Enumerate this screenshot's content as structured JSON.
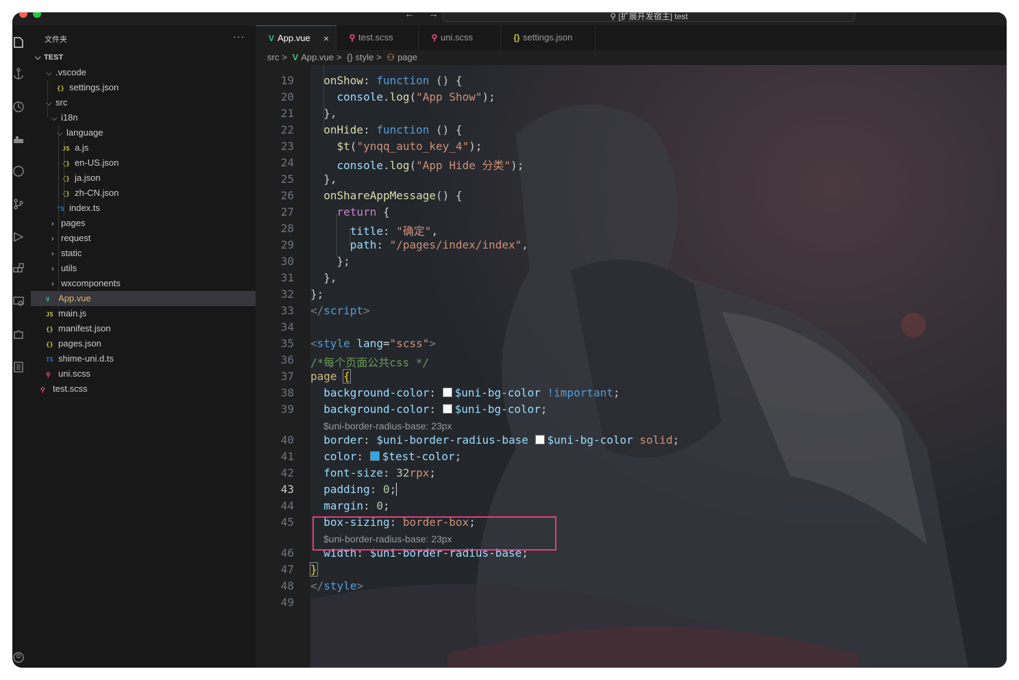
{
  "window": {
    "nav": "← →",
    "command_center": "⚲ [扩展开发宿主] test"
  },
  "sidebar": {
    "title": "文件夹",
    "more": "···",
    "root": "TEST",
    "tree": [
      {
        "label": ".vscode",
        "icon": "",
        "type": "folder-open"
      },
      {
        "label": "settings.json",
        "icon": "{}",
        "type": "json"
      },
      {
        "label": "src",
        "icon": "",
        "type": "folder-open"
      },
      {
        "label": "i18n",
        "icon": "",
        "type": "folder-open"
      },
      {
        "label": "language",
        "icon": "",
        "type": "folder-open"
      },
      {
        "label": "a.js",
        "icon": "JS",
        "type": "js"
      },
      {
        "label": "en-US.json",
        "icon": "{}",
        "type": "json"
      },
      {
        "label": "ja.json",
        "icon": "{}",
        "type": "json"
      },
      {
        "label": "zh-CN.json",
        "icon": "{}",
        "type": "json"
      },
      {
        "label": "index.ts",
        "icon": "TS",
        "type": "ts"
      },
      {
        "label": "pages",
        "icon": "",
        "type": "folder"
      },
      {
        "label": "request",
        "icon": "",
        "type": "folder"
      },
      {
        "label": "static",
        "icon": "",
        "type": "folder"
      },
      {
        "label": "utils",
        "icon": "",
        "type": "folder"
      },
      {
        "label": "wxcomponents",
        "icon": "",
        "type": "folder"
      },
      {
        "label": "App.vue",
        "icon": "V",
        "type": "vue"
      },
      {
        "label": "main.js",
        "icon": "JS",
        "type": "js"
      },
      {
        "label": "manifest.json",
        "icon": "{}",
        "type": "json"
      },
      {
        "label": "pages.json",
        "icon": "{}",
        "type": "json"
      },
      {
        "label": "shime-uni.d.ts",
        "icon": "TS",
        "type": "ts"
      },
      {
        "label": "uni.scss",
        "icon": "⚲",
        "type": "scss"
      },
      {
        "label": "test.scss",
        "icon": "⚲",
        "type": "scss"
      }
    ]
  },
  "tabs": [
    {
      "label": "App.vue",
      "icon": "V",
      "close": "×"
    },
    {
      "label": "test.scss",
      "icon": "⚲"
    },
    {
      "label": "uni.scss",
      "icon": "⚲"
    },
    {
      "label": "settings.json",
      "icon": "{}"
    }
  ],
  "breadcrumb": {
    "src": "src",
    "file": "App.vue",
    "style": "{} style",
    "page": "page",
    "sep": ">"
  },
  "editor": {
    "line_numbers": [
      "19",
      "20",
      "21",
      "22",
      "23",
      "24",
      "25",
      "26",
      "27",
      "28",
      "29",
      "30",
      "31",
      "32",
      "33",
      "34",
      "35",
      "36",
      "37",
      "38",
      "39",
      "40",
      "41",
      "42",
      "43",
      "44",
      "45",
      "46",
      "47",
      "48",
      "49"
    ],
    "current_line": "43",
    "hints": [
      "$uni-border-radius-base: 23px",
      "$uni-border-radius-base: 23px"
    ],
    "swatch_colors": {
      "bg": "#ffffff",
      "bg2": "#f8f8f8",
      "test": "#2ea8e6"
    }
  },
  "colors": {
    "accent": "#0078d4",
    "highlight_box": "#e0407b",
    "vue_green": "#41b883",
    "js_yellow": "#cbcb41",
    "ts_blue": "#3178c6",
    "scss_pink": "#f55385"
  }
}
